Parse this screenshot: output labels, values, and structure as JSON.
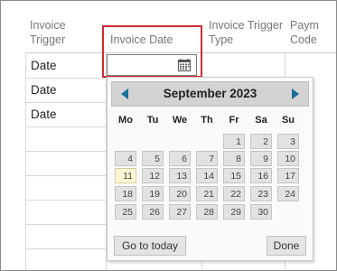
{
  "columns": {
    "invoice_trigger": "Invoice Trigger",
    "invoice_date": "Invoice Date",
    "invoice_trigger_type": "Invoice Trigger Type",
    "payment_code": "Paym Code"
  },
  "rows": [
    "Date",
    "Date",
    "Date"
  ],
  "date_input": {
    "value": ""
  },
  "calendar": {
    "month_label": "September 2023",
    "weekdays": [
      "Mo",
      "Tu",
      "We",
      "Th",
      "Fr",
      "Sa",
      "Su"
    ],
    "weeks": [
      [
        "",
        "",
        "",
        "",
        "1",
        "2",
        "3"
      ],
      [
        "4",
        "5",
        "6",
        "7",
        "8",
        "9",
        "10"
      ],
      [
        "11",
        "12",
        "13",
        "14",
        "15",
        "16",
        "17"
      ],
      [
        "18",
        "19",
        "20",
        "21",
        "22",
        "23",
        "24"
      ],
      [
        "25",
        "26",
        "27",
        "28",
        "29",
        "30",
        ""
      ]
    ],
    "today": "11",
    "go_to_today_label": "Go to today",
    "done_label": "Done"
  }
}
